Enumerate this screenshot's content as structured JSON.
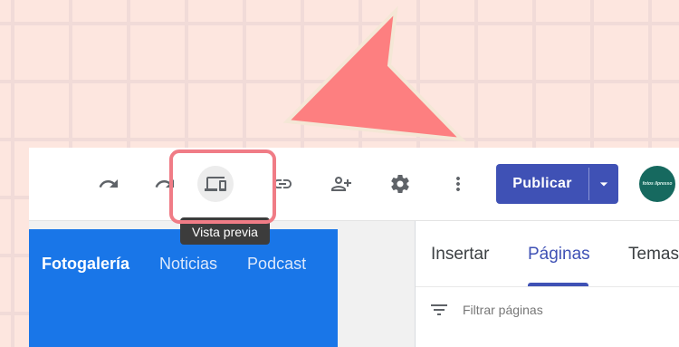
{
  "toolbar": {
    "undo_icon": "undo-icon",
    "redo_icon": "redo-icon",
    "preview_icon": "devices-icon",
    "link_icon": "link-icon",
    "share_icon": "person-add-icon",
    "settings_icon": "gear-icon",
    "more_icon": "more-vert-icon",
    "publish_label": "Publicar",
    "publish_color": "#3f51b5",
    "avatar_text": "fotos ilpresso"
  },
  "tooltip": {
    "text": "Vista previa"
  },
  "site": {
    "header_color": "#1976e8",
    "nav": [
      {
        "label": "Fotogalería",
        "active": true
      },
      {
        "label": "Noticias",
        "active": false
      },
      {
        "label": "Podcast",
        "active": false
      }
    ]
  },
  "panel": {
    "tabs": [
      {
        "label": "Insertar",
        "active": false
      },
      {
        "label": "Páginas",
        "active": true
      },
      {
        "label": "Temas",
        "active": false
      }
    ],
    "filter_placeholder": "Filtrar páginas"
  },
  "annotation": {
    "arrow_color": "#fd7f80",
    "highlight_color": "#f07c86"
  }
}
